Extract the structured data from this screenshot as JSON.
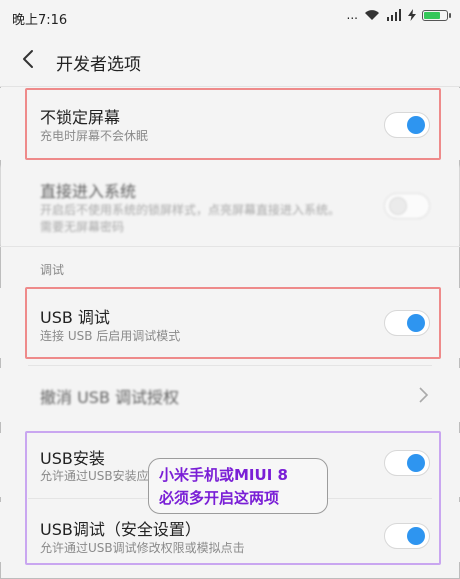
{
  "status_bar": {
    "time": "晚上7:16",
    "signal_text": "..."
  },
  "header": {
    "title": "开发者选项"
  },
  "rows": {
    "stay_awake": {
      "title": "不锁定屏幕",
      "subtitle": "充电时屏幕不会休眠",
      "toggle": "on"
    },
    "direct_boot": {
      "title": "直接进入系统",
      "subtitle_line1": "开启后不使用系统的锁屏样式，点亮屏幕直接进入系统。",
      "subtitle_line2": "需要无屏幕密码",
      "toggle": "off"
    },
    "usb_debug": {
      "title": "USB 调试",
      "subtitle": "连接 USB 后启用调试模式",
      "toggle": "on"
    },
    "revoke_usb": {
      "title": "撤消 USB 调试授权"
    },
    "usb_install": {
      "title": "USB安装",
      "subtitle": "允许通过USB安装应用",
      "toggle": "on"
    },
    "usb_debug_secure": {
      "title": "USB调试（安全设置）",
      "subtitle": "允许通过USB调试修改权限或模拟点击",
      "toggle": "on"
    }
  },
  "section": {
    "debug_label": "调试"
  },
  "callout": {
    "line1": "小米手机或MIUI 8",
    "line2": "必须多开启这两项"
  },
  "colors": {
    "accent": "#2e95f0",
    "highlight_red": "#ee8a8a",
    "highlight_purple": "#c9a6f0",
    "callout_text": "#7a1fd6"
  }
}
